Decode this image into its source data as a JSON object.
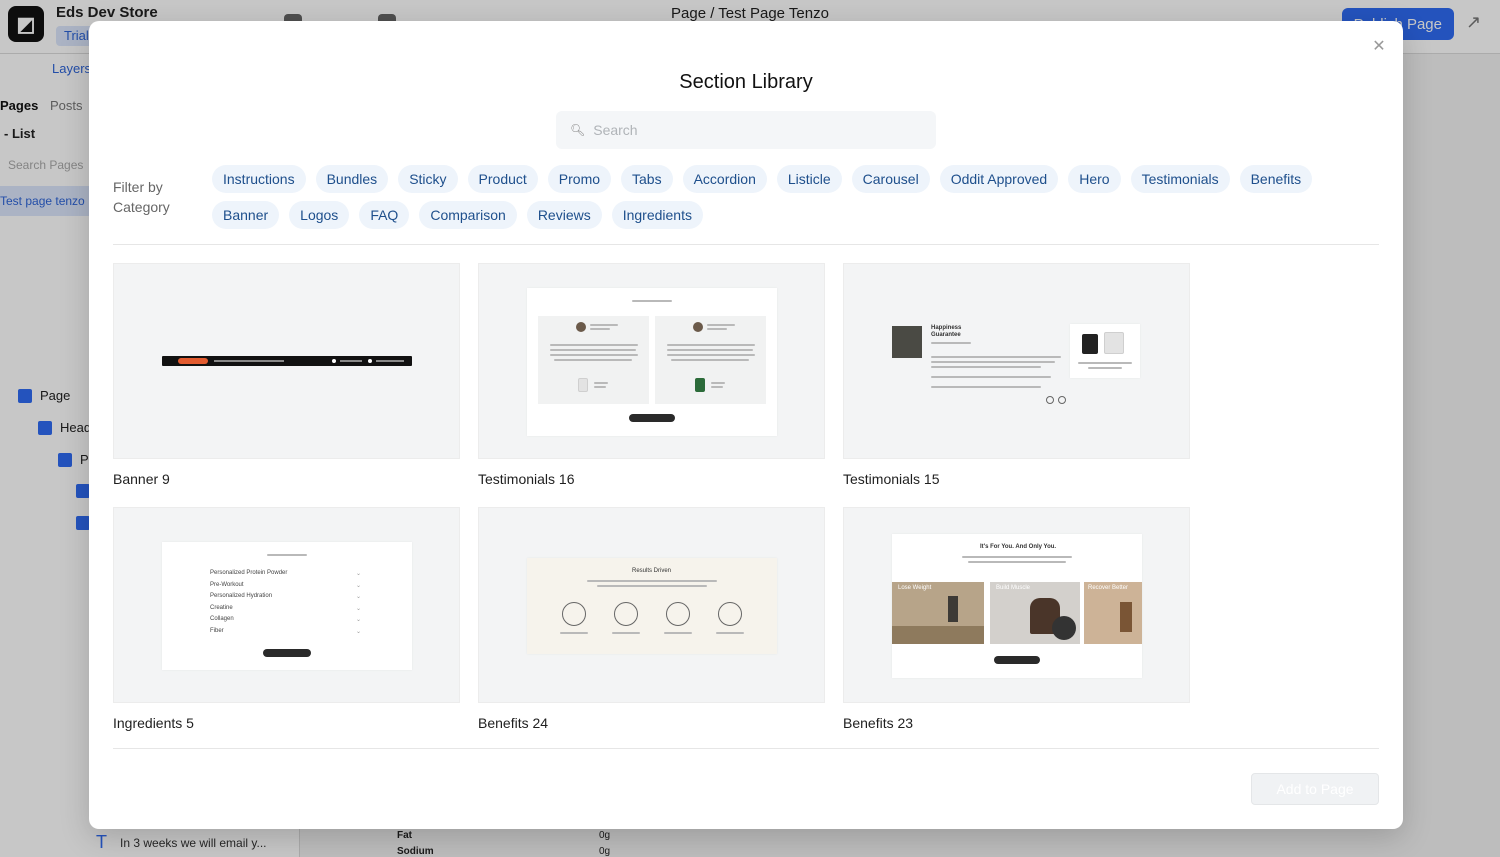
{
  "app": {
    "store_name": "Eds Dev Store",
    "trial_badge": "Trial",
    "page_path": "Page / Test Page Tenzo",
    "publish_label": "Publish Page"
  },
  "sidebar": {
    "layers_tab": "Layers",
    "tabs": [
      "Pages",
      "Posts"
    ],
    "list_label": "List",
    "search_placeholder": "Search Pages",
    "active_page": "Test page tenzo",
    "layers": [
      {
        "label": "Page"
      },
      {
        "label": "Head"
      },
      {
        "label": "P"
      }
    ],
    "bottom_text": "In 3 weeks we will email y..."
  },
  "canvas": {
    "nutrition": [
      {
        "label": "Fat",
        "value": "0g"
      },
      {
        "label": "Sodium",
        "value": "0g"
      }
    ]
  },
  "modal": {
    "title": "Section Library",
    "search_placeholder": "Search",
    "search_value": "",
    "filter_label": "Filter by Category",
    "categories": [
      "Instructions",
      "Bundles",
      "Sticky",
      "Product",
      "Promo",
      "Tabs",
      "Accordion",
      "Listicle",
      "Carousel",
      "Oddit Approved",
      "Hero",
      "Testimonials",
      "Benefits",
      "Banner",
      "Logos",
      "FAQ",
      "Comparison",
      "Reviews",
      "Ingredients"
    ],
    "sections": [
      {
        "name": "Banner 9"
      },
      {
        "name": "Testimonials 16"
      },
      {
        "name": "Testimonials 15"
      },
      {
        "name": "Ingredients 5"
      },
      {
        "name": "Benefits 24"
      },
      {
        "name": "Benefits 23"
      }
    ],
    "thumb_text": {
      "happiness_1": "Happiness",
      "happiness_2": "Guarantee",
      "ingredients": [
        "Personalized Protein Powder",
        "Pre-Workout",
        "Personalized Hydration",
        "Creatine",
        "Collagen",
        "Fiber"
      ],
      "results_title": "Results Driven",
      "benefit_title": "It's For You. And Only You.",
      "benefit_tiles": [
        "Lose Weight",
        "Build Muscle",
        "Recover Better"
      ]
    },
    "add_button": "Add to Page"
  }
}
